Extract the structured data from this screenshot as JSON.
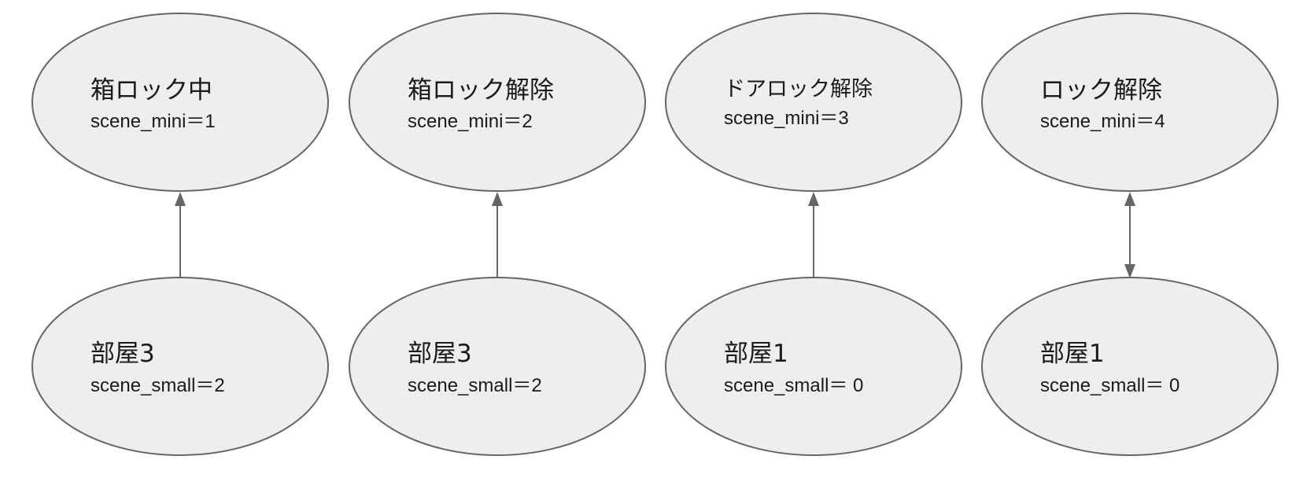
{
  "nodes": [
    {
      "id": "top-1",
      "title": "箱ロック中",
      "subtitle": "scene_mini＝1"
    },
    {
      "id": "top-2",
      "title": "箱ロック解除",
      "subtitle": "scene_mini＝2"
    },
    {
      "id": "top-3",
      "title": "ドアロック解除",
      "subtitle": "scene_mini＝3"
    },
    {
      "id": "top-4",
      "title": "ロック解除",
      "subtitle": "scene_mini＝4"
    },
    {
      "id": "bottom-1",
      "title": "部屋3",
      "subtitle": "scene_small＝2"
    },
    {
      "id": "bottom-2",
      "title": "部屋3",
      "subtitle": "scene_small＝2"
    },
    {
      "id": "bottom-3",
      "title": "部屋1",
      "subtitle": "scene_small＝ 0"
    },
    {
      "id": "bottom-4",
      "title": "部屋1",
      "subtitle": "scene_small＝ 0"
    }
  ],
  "edges": [
    {
      "from": "bottom-1",
      "to": "top-1",
      "direction": "forward"
    },
    {
      "from": "bottom-2",
      "to": "top-2",
      "direction": "forward"
    },
    {
      "from": "bottom-3",
      "to": "top-3",
      "direction": "forward"
    },
    {
      "from": "bottom-4",
      "to": "top-4",
      "direction": "both"
    }
  ],
  "colors": {
    "node_fill": "#eeeeee",
    "node_stroke": "#666666",
    "edge": "#666666",
    "text": "#1a1a1a"
  }
}
